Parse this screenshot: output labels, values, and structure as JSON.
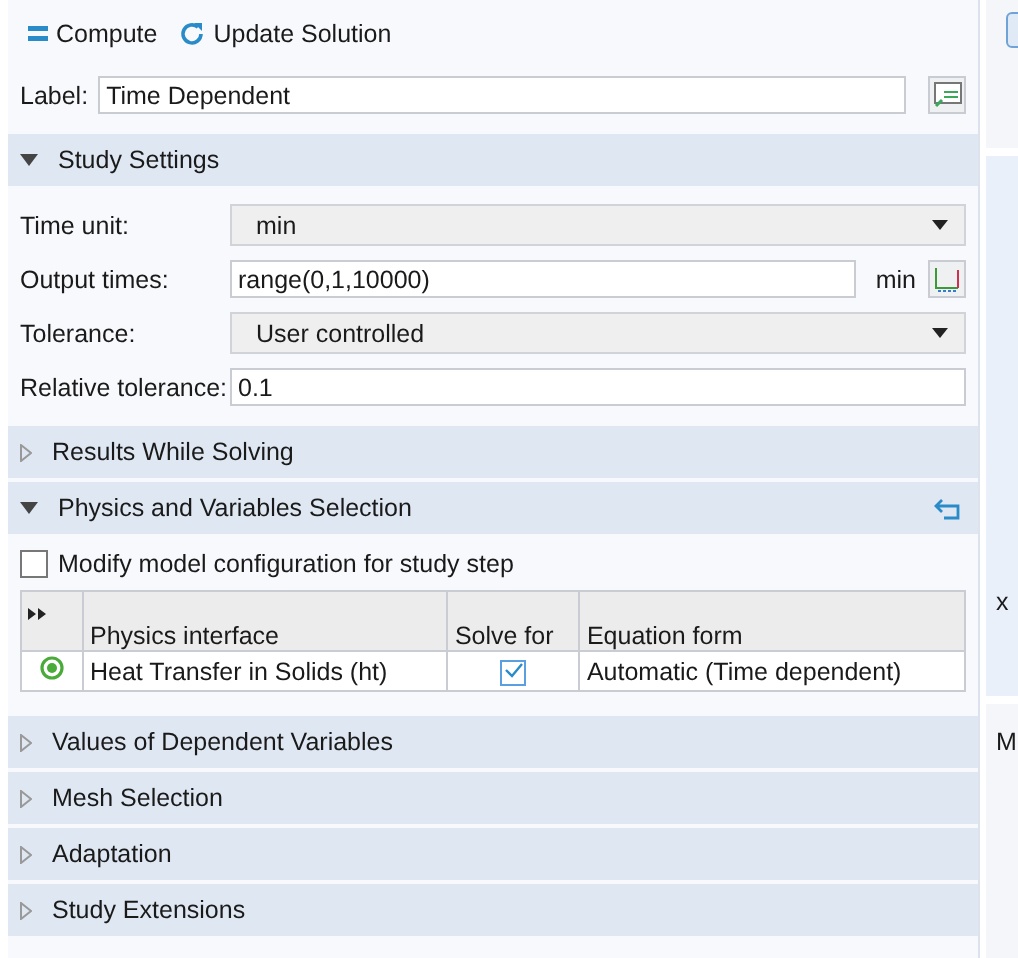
{
  "toolbar": [
    {
      "kind": "compute",
      "label": "Compute"
    },
    {
      "kind": "update",
      "label": "Update Solution"
    }
  ],
  "label_field": {
    "label": "Label:",
    "value": "Time Dependent"
  },
  "sections": [
    {
      "title": "Study Settings",
      "expanded": true,
      "kind": "settings",
      "fields": [
        {
          "kind": "select",
          "label": "Time unit:",
          "value": "min"
        },
        {
          "kind": "input",
          "label": "Output times:",
          "value": "range(0,1,10000)",
          "unit": "min"
        },
        {
          "kind": "select",
          "label": "Tolerance:",
          "value": "User controlled"
        },
        {
          "kind": "input",
          "label": "Relative tolerance:",
          "value": "0.1"
        }
      ]
    },
    {
      "title": "Results While Solving",
      "expanded": false,
      "kind": "plain"
    },
    {
      "title": "Physics and Variables Selection",
      "expanded": true,
      "kind": "physics",
      "checkbox": {
        "label": "Modify model configuration for study step",
        "checked": false
      },
      "table": {
        "columns": [
          "Physics interface",
          "Solve for",
          "Equation form"
        ],
        "rows": [
          {
            "physics": "Heat Transfer in Solids (ht)",
            "solve_for": true,
            "equation_form": "Automatic (Time dependent)"
          }
        ]
      }
    },
    {
      "title": "Values of Dependent Variables",
      "expanded": false,
      "kind": "plain"
    },
    {
      "title": "Mesh Selection",
      "expanded": false,
      "kind": "plain"
    },
    {
      "title": "Adaptation",
      "expanded": false,
      "kind": "plain"
    },
    {
      "title": "Study Extensions",
      "expanded": false,
      "kind": "plain"
    }
  ],
  "right_panel": {
    "text_1": "x",
    "text_2": "M"
  }
}
